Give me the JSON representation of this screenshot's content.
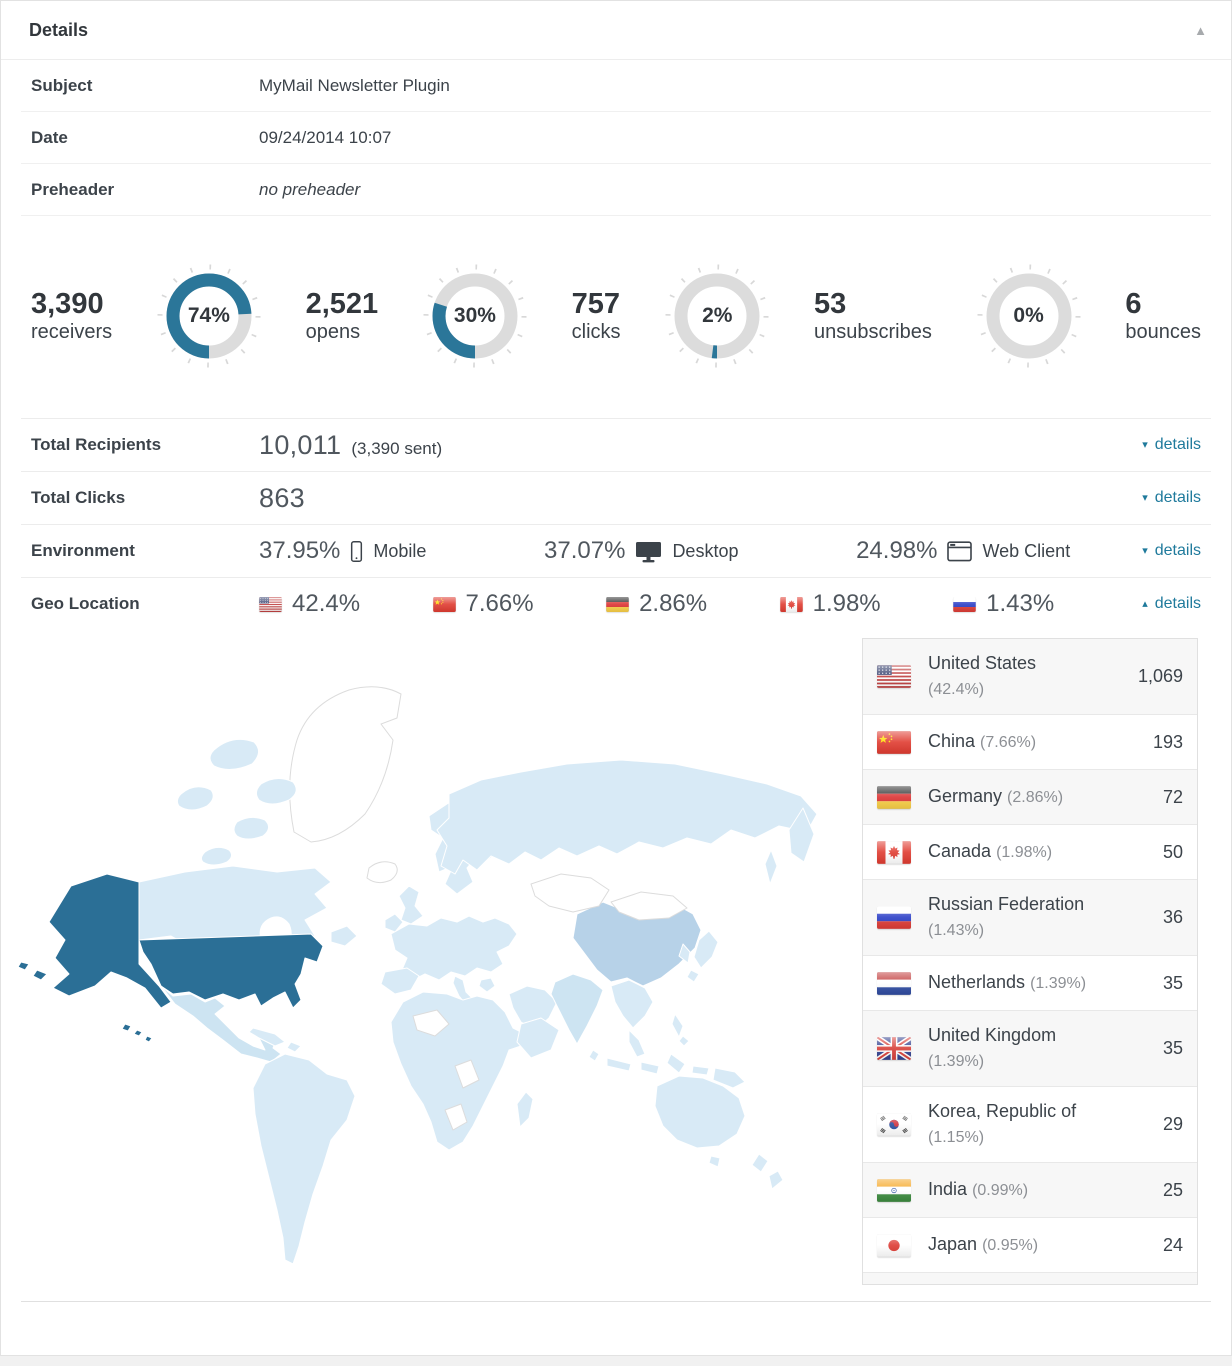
{
  "header": {
    "title": "Details",
    "collapse_icon": "triangle-up-icon"
  },
  "meta": [
    {
      "label": "Subject",
      "value": "MyMail Newsletter Plugin",
      "italic": false
    },
    {
      "label": "Date",
      "value": "09/24/2014 10:07",
      "italic": false
    },
    {
      "label": "Preheader",
      "value": "no preheader",
      "italic": true
    }
  ],
  "stats": [
    {
      "type": "number",
      "value": "3,390",
      "label": "receivers"
    },
    {
      "type": "gauge",
      "percent": 74,
      "label": "74%"
    },
    {
      "type": "number",
      "value": "2,521",
      "label": "opens"
    },
    {
      "type": "gauge",
      "percent": 30,
      "label": "30%"
    },
    {
      "type": "number",
      "value": "757",
      "label": "clicks"
    },
    {
      "type": "gauge",
      "percent": 2,
      "label": "2%"
    },
    {
      "type": "number",
      "value": "53",
      "label": "unsubscribes"
    },
    {
      "type": "gauge",
      "percent": 0,
      "label": "0%"
    },
    {
      "type": "number",
      "value": "6",
      "label": "bounces"
    }
  ],
  "detail_rows": [
    {
      "id": "total-recipients",
      "label": "Total Recipients",
      "type": "value",
      "value": "10,011",
      "note": "(3,390 sent)",
      "details_label": "details",
      "chevron": "down"
    },
    {
      "id": "total-clicks",
      "label": "Total Clicks",
      "type": "value",
      "value": "863",
      "note": "",
      "details_label": "details",
      "chevron": "down"
    },
    {
      "id": "environment",
      "label": "Environment",
      "type": "env",
      "items": [
        {
          "percent": "37.95%",
          "icon": "mobile-icon",
          "name": "Mobile"
        },
        {
          "percent": "37.07%",
          "icon": "desktop-icon",
          "name": "Desktop"
        },
        {
          "percent": "24.98%",
          "icon": "web-client-icon",
          "name": "Web Client"
        }
      ],
      "details_label": "details",
      "chevron": "down"
    },
    {
      "id": "geo-location",
      "label": "Geo Location",
      "type": "geo",
      "items": [
        {
          "flag": "us",
          "percent": "42.4%"
        },
        {
          "flag": "cn",
          "percent": "7.66%"
        },
        {
          "flag": "de",
          "percent": "2.86%"
        },
        {
          "flag": "ca",
          "percent": "1.98%"
        },
        {
          "flag": "ru",
          "percent": "1.43%"
        }
      ],
      "details_label": "details",
      "chevron": "up"
    }
  ],
  "geo_table": [
    {
      "flag": "us",
      "country": "United States",
      "percent": "(42.4%)",
      "count": "1,069"
    },
    {
      "flag": "cn",
      "country": "China",
      "percent": "(7.66%)",
      "count": "193"
    },
    {
      "flag": "de",
      "country": "Germany",
      "percent": "(2.86%)",
      "count": "72"
    },
    {
      "flag": "ca",
      "country": "Canada",
      "percent": "(1.98%)",
      "count": "50"
    },
    {
      "flag": "ru",
      "country": "Russian Federation",
      "percent": "(1.43%)",
      "count": "36"
    },
    {
      "flag": "nl",
      "country": "Netherlands",
      "percent": "(1.39%)",
      "count": "35"
    },
    {
      "flag": "gb",
      "country": "United Kingdom",
      "percent": "(1.39%)",
      "count": "35"
    },
    {
      "flag": "kr",
      "country": "Korea, Republic of",
      "percent": "(1.15%)",
      "count": "29"
    },
    {
      "flag": "in",
      "country": "India",
      "percent": "(0.99%)",
      "count": "25"
    },
    {
      "flag": "jp",
      "country": "Japan",
      "percent": "(0.95%)",
      "count": "24"
    }
  ],
  "colors": {
    "accent": "#1f7a9c",
    "gauge_fill": "#2b7699",
    "gauge_track": "#dcdcdc",
    "map_default": "#d8eaf6",
    "map_no_data": "#ffffff",
    "map_united_states": "#2b6f96",
    "map_china": "#b7d2e8"
  }
}
